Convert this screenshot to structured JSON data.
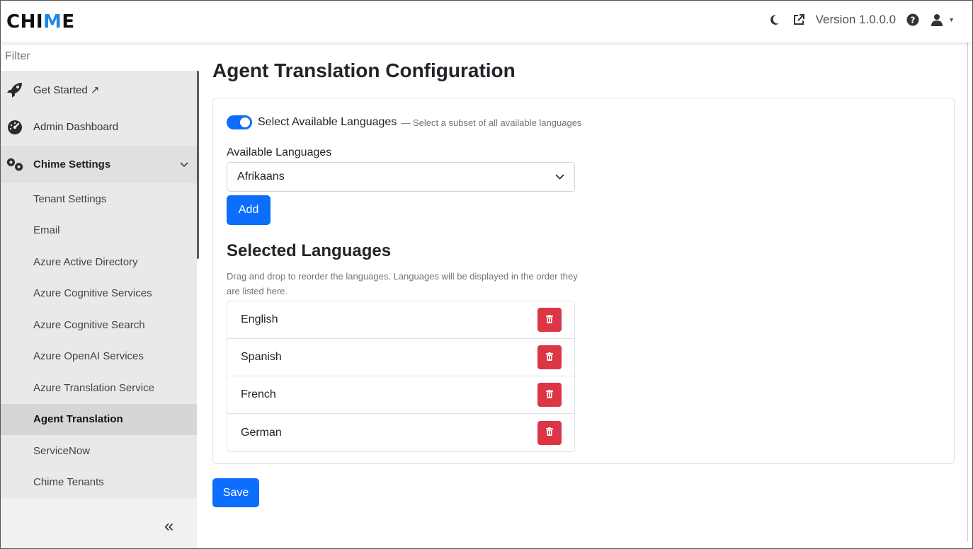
{
  "header": {
    "logo_prefix": "CHI",
    "logo_highlight": "M",
    "logo_suffix": "E",
    "version": "Version 1.0.0.0",
    "icons": [
      "moon-icon",
      "external-link-icon",
      "help-icon",
      "user-icon"
    ]
  },
  "sidebar": {
    "filter_placeholder": "Filter",
    "items": [
      {
        "label": "Get Started ↗",
        "icon": "rocket-icon"
      },
      {
        "label": "Admin Dashboard",
        "icon": "dashboard-icon"
      }
    ],
    "settings": {
      "label": "Chime Settings",
      "icon": "gears-icon",
      "subitems": [
        "Tenant Settings",
        "Email",
        "Azure Active Directory",
        "Azure Cognitive Services",
        "Azure Cognitive Search",
        "Azure OpenAI Services",
        "Azure Translation Service",
        "Agent Translation",
        "ServiceNow",
        "Chime Tenants"
      ],
      "active_index": 7
    },
    "collapse_glyph": "«"
  },
  "main": {
    "title": "Agent Translation Configuration",
    "toggle": {
      "label": "Select Available Languages",
      "help": "— Select a subset of all available languages",
      "checked": true
    },
    "available_label": "Available Languages",
    "available_selected": "Afrikaans",
    "add_label": "Add",
    "selected_title": "Selected Languages",
    "selected_help": "Drag and drop to reorder the languages. Languages will be displayed in the order they are listed here.",
    "languages": [
      "English",
      "Spanish",
      "French",
      "German"
    ],
    "save_label": "Save"
  },
  "colors": {
    "primary": "#0d6efd",
    "danger": "#dc3545",
    "logo_accent": "#1e88e5"
  }
}
